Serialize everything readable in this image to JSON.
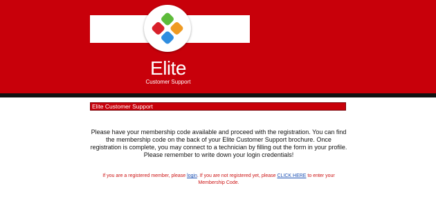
{
  "header": {
    "logo": {
      "title": "Elite",
      "subtitle": "Customer Support",
      "icon": "four-petal-logo-icon",
      "petal_colors": [
        "#5dbb3a",
        "#ef9a22",
        "#d8202a",
        "#2f8de0"
      ]
    },
    "colors": {
      "brand_red": "#c8000a",
      "divider": "#111111"
    }
  },
  "main": {
    "section_title": "Elite Customer Support",
    "intro": "Please have your membership code available and proceed with the registration. You can find the membership code on the back of your Elite Customer Support brochure. Once registration is complete, you may connect to a technician by filling out the form in your profile. Please remember to write down your login credentials!",
    "notice": {
      "part1": "If you are a registered member, please ",
      "login_link": "login",
      "part2": ". If you are not registered yet, please ",
      "click_here_link": "CLICK HERE",
      "part3": " to enter your Membership Code."
    }
  }
}
